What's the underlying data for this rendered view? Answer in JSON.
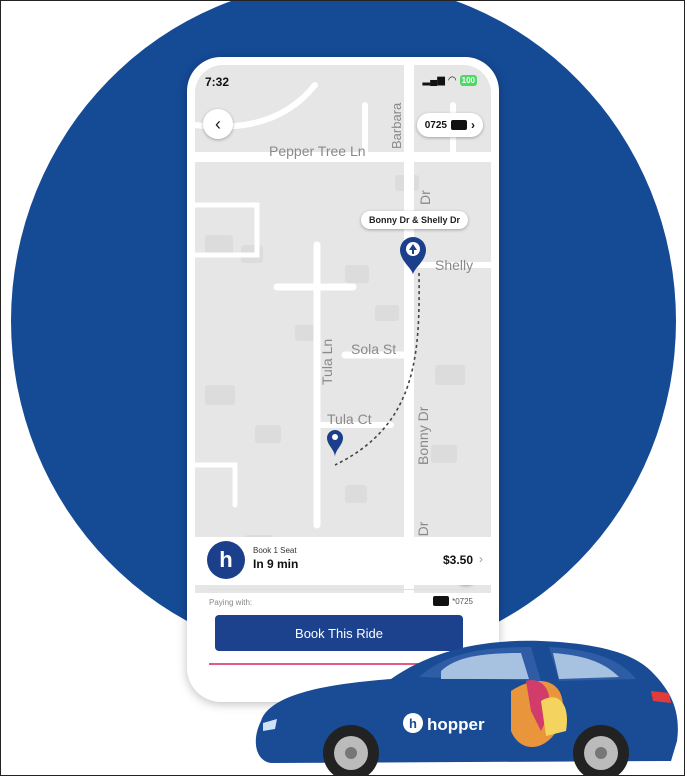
{
  "status_bar": {
    "time": "7:32",
    "battery": "100"
  },
  "header": {
    "back_symbol": "‹",
    "card_last4": "0725"
  },
  "map": {
    "stop_label": "Bonny Dr & Shelly Dr",
    "streets": [
      "Pepper Tree Ln",
      "Barbara",
      "Shelly",
      "Sola St",
      "Tula Ln",
      "Tula Ct",
      "Bonny Dr",
      "Bonny Dr",
      "Dr"
    ]
  },
  "ride": {
    "title": "Book 1 Seat",
    "eta": "In 9 min",
    "price": "$3.50",
    "logo_letter": "h"
  },
  "payment": {
    "label": "Paying with:",
    "card": "*0725"
  },
  "book_button": "Book This Ride",
  "car": {
    "brand": "hopper"
  },
  "colors": {
    "brand_blue": "#154a95",
    "button_blue": "#1c418d",
    "accent_pink": "#e25a86"
  }
}
